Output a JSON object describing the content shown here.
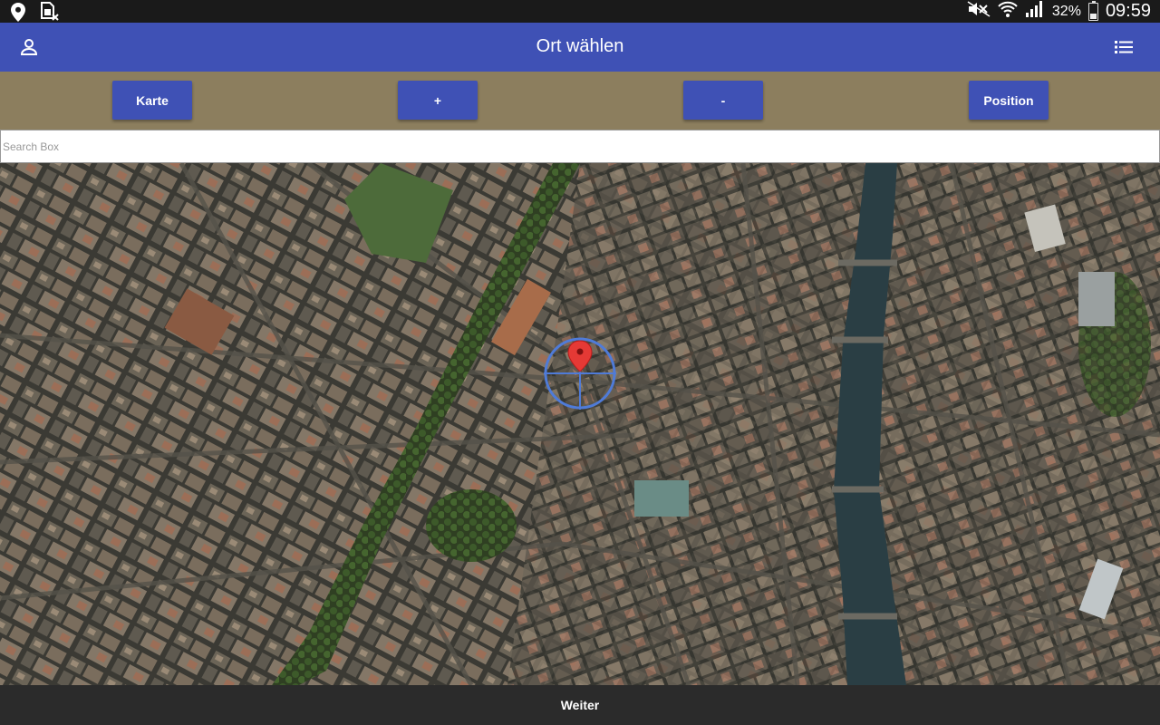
{
  "status_bar": {
    "left_icons": [
      "location-icon",
      "sim-off-icon"
    ],
    "right_icons": [
      "mute-icon",
      "wifi-icon",
      "signal-icon"
    ],
    "battery_percent": "32%",
    "battery_level": 0.32,
    "time": "09:59"
  },
  "app_bar": {
    "title": "Ort wählen",
    "left_icon": "person-icon",
    "right_icon": "list-icon",
    "color": "#3f51b5"
  },
  "toolbar": {
    "background": "#8c7e5e",
    "buttons": {
      "karte": "Karte",
      "zoom_in": "+",
      "zoom_out": "-",
      "position": "Position"
    }
  },
  "search": {
    "placeholder": "Search Box",
    "value": ""
  },
  "map": {
    "type": "satellite",
    "marker_icon": "map-pin-icon",
    "crosshair_icon": "crosshair-icon"
  },
  "bottom_bar": {
    "label": "Weiter"
  }
}
